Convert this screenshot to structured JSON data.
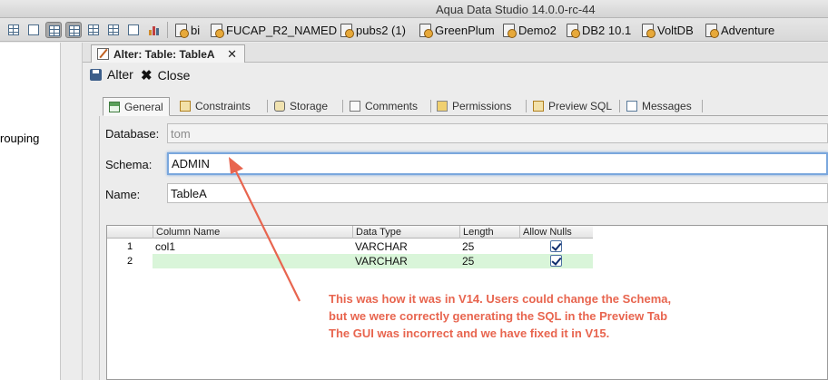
{
  "window": {
    "title": "Aqua Data Studio 14.0.0-rc-44"
  },
  "toolbar": {
    "servers": [
      "bi",
      "FUCAP_R2_NAMED",
      "pubs2 (1)",
      "GreenPlum",
      "Demo2",
      "DB2 10.1",
      "VoltDB",
      "Adventure"
    ]
  },
  "sidebar": {
    "partial_text": "rouping"
  },
  "editor_tab": {
    "label": "Alter: Table: TableA",
    "close_glyph": "✕"
  },
  "actions": {
    "alter_label": "Alter",
    "close_label": "Close"
  },
  "content_tabs": [
    "General",
    "Constraints",
    "Storage",
    "Comments",
    "Permissions",
    "Preview SQL",
    "Messages"
  ],
  "form": {
    "database_label": "Database:",
    "database_value": "tom",
    "schema_label": "Schema:",
    "schema_value": "ADMIN",
    "name_label": "Name:",
    "name_value": "TableA"
  },
  "grid": {
    "headers": [
      "Column Name",
      "Data Type",
      "Length",
      "Allow Nulls"
    ],
    "rows": [
      {
        "num": "1",
        "column_name": "col1",
        "data_type": "VARCHAR",
        "length": "25",
        "allow_nulls": true
      },
      {
        "num": "2",
        "column_name": "",
        "data_type": "VARCHAR",
        "length": "25",
        "allow_nulls": true
      }
    ]
  },
  "annotation": {
    "lines": [
      "This was how it was in V14. Users could change the Schema,",
      "but we were correctly generating the SQL in the Preview Tab",
      "The GUI was incorrect and we have fixed it in V15."
    ],
    "color": "#e8654f"
  }
}
